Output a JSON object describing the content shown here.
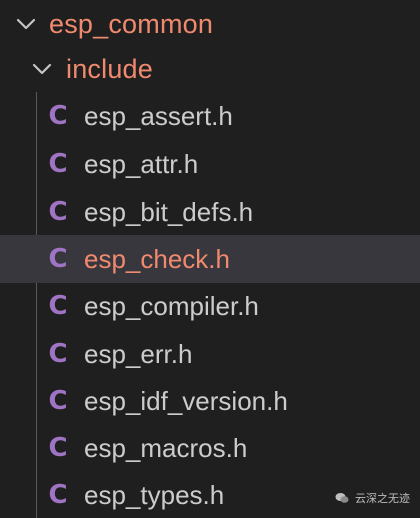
{
  "explorer": {
    "root_folder": {
      "label": "esp_common",
      "expanded": true,
      "icon": "chevron-down-icon"
    },
    "sub_folder": {
      "label": "include",
      "expanded": true,
      "icon": "chevron-down-icon"
    },
    "file_icon_glyph": "C",
    "file_icon_color": "#a074c4",
    "files": [
      {
        "name": "esp_assert.h",
        "selected": false
      },
      {
        "name": "esp_attr.h",
        "selected": false
      },
      {
        "name": "esp_bit_defs.h",
        "selected": false
      },
      {
        "name": "esp_check.h",
        "selected": true
      },
      {
        "name": "esp_compiler.h",
        "selected": false
      },
      {
        "name": "esp_err.h",
        "selected": false
      },
      {
        "name": "esp_idf_version.h",
        "selected": false
      },
      {
        "name": "esp_macros.h",
        "selected": false
      },
      {
        "name": "esp_types.h",
        "selected": false
      }
    ]
  },
  "colors": {
    "background": "#1f1f1f",
    "selected_row": "#37373d",
    "folder_text": "#f08a6e",
    "file_text": "#cccccc",
    "selected_text": "#f08a6e",
    "indent_guide": "#5a5a5a"
  },
  "watermark": {
    "text": "云深之无迹",
    "icon": "wechat-icon"
  }
}
